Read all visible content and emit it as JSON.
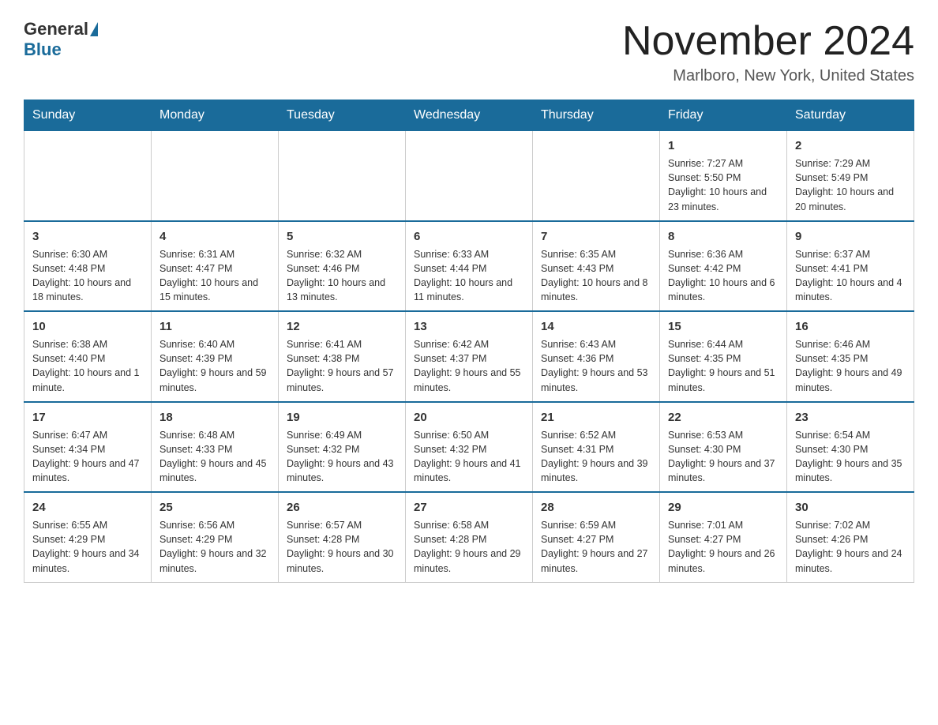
{
  "logo": {
    "general": "General",
    "blue": "Blue"
  },
  "header": {
    "title": "November 2024",
    "subtitle": "Marlboro, New York, United States"
  },
  "weekdays": [
    "Sunday",
    "Monday",
    "Tuesday",
    "Wednesday",
    "Thursday",
    "Friday",
    "Saturday"
  ],
  "weeks": [
    [
      {
        "day": "",
        "info": ""
      },
      {
        "day": "",
        "info": ""
      },
      {
        "day": "",
        "info": ""
      },
      {
        "day": "",
        "info": ""
      },
      {
        "day": "",
        "info": ""
      },
      {
        "day": "1",
        "info": "Sunrise: 7:27 AM\nSunset: 5:50 PM\nDaylight: 10 hours and 23 minutes."
      },
      {
        "day": "2",
        "info": "Sunrise: 7:29 AM\nSunset: 5:49 PM\nDaylight: 10 hours and 20 minutes."
      }
    ],
    [
      {
        "day": "3",
        "info": "Sunrise: 6:30 AM\nSunset: 4:48 PM\nDaylight: 10 hours and 18 minutes."
      },
      {
        "day": "4",
        "info": "Sunrise: 6:31 AM\nSunset: 4:47 PM\nDaylight: 10 hours and 15 minutes."
      },
      {
        "day": "5",
        "info": "Sunrise: 6:32 AM\nSunset: 4:46 PM\nDaylight: 10 hours and 13 minutes."
      },
      {
        "day": "6",
        "info": "Sunrise: 6:33 AM\nSunset: 4:44 PM\nDaylight: 10 hours and 11 minutes."
      },
      {
        "day": "7",
        "info": "Sunrise: 6:35 AM\nSunset: 4:43 PM\nDaylight: 10 hours and 8 minutes."
      },
      {
        "day": "8",
        "info": "Sunrise: 6:36 AM\nSunset: 4:42 PM\nDaylight: 10 hours and 6 minutes."
      },
      {
        "day": "9",
        "info": "Sunrise: 6:37 AM\nSunset: 4:41 PM\nDaylight: 10 hours and 4 minutes."
      }
    ],
    [
      {
        "day": "10",
        "info": "Sunrise: 6:38 AM\nSunset: 4:40 PM\nDaylight: 10 hours and 1 minute."
      },
      {
        "day": "11",
        "info": "Sunrise: 6:40 AM\nSunset: 4:39 PM\nDaylight: 9 hours and 59 minutes."
      },
      {
        "day": "12",
        "info": "Sunrise: 6:41 AM\nSunset: 4:38 PM\nDaylight: 9 hours and 57 minutes."
      },
      {
        "day": "13",
        "info": "Sunrise: 6:42 AM\nSunset: 4:37 PM\nDaylight: 9 hours and 55 minutes."
      },
      {
        "day": "14",
        "info": "Sunrise: 6:43 AM\nSunset: 4:36 PM\nDaylight: 9 hours and 53 minutes."
      },
      {
        "day": "15",
        "info": "Sunrise: 6:44 AM\nSunset: 4:35 PM\nDaylight: 9 hours and 51 minutes."
      },
      {
        "day": "16",
        "info": "Sunrise: 6:46 AM\nSunset: 4:35 PM\nDaylight: 9 hours and 49 minutes."
      }
    ],
    [
      {
        "day": "17",
        "info": "Sunrise: 6:47 AM\nSunset: 4:34 PM\nDaylight: 9 hours and 47 minutes."
      },
      {
        "day": "18",
        "info": "Sunrise: 6:48 AM\nSunset: 4:33 PM\nDaylight: 9 hours and 45 minutes."
      },
      {
        "day": "19",
        "info": "Sunrise: 6:49 AM\nSunset: 4:32 PM\nDaylight: 9 hours and 43 minutes."
      },
      {
        "day": "20",
        "info": "Sunrise: 6:50 AM\nSunset: 4:32 PM\nDaylight: 9 hours and 41 minutes."
      },
      {
        "day": "21",
        "info": "Sunrise: 6:52 AM\nSunset: 4:31 PM\nDaylight: 9 hours and 39 minutes."
      },
      {
        "day": "22",
        "info": "Sunrise: 6:53 AM\nSunset: 4:30 PM\nDaylight: 9 hours and 37 minutes."
      },
      {
        "day": "23",
        "info": "Sunrise: 6:54 AM\nSunset: 4:30 PM\nDaylight: 9 hours and 35 minutes."
      }
    ],
    [
      {
        "day": "24",
        "info": "Sunrise: 6:55 AM\nSunset: 4:29 PM\nDaylight: 9 hours and 34 minutes."
      },
      {
        "day": "25",
        "info": "Sunrise: 6:56 AM\nSunset: 4:29 PM\nDaylight: 9 hours and 32 minutes."
      },
      {
        "day": "26",
        "info": "Sunrise: 6:57 AM\nSunset: 4:28 PM\nDaylight: 9 hours and 30 minutes."
      },
      {
        "day": "27",
        "info": "Sunrise: 6:58 AM\nSunset: 4:28 PM\nDaylight: 9 hours and 29 minutes."
      },
      {
        "day": "28",
        "info": "Sunrise: 6:59 AM\nSunset: 4:27 PM\nDaylight: 9 hours and 27 minutes."
      },
      {
        "day": "29",
        "info": "Sunrise: 7:01 AM\nSunset: 4:27 PM\nDaylight: 9 hours and 26 minutes."
      },
      {
        "day": "30",
        "info": "Sunrise: 7:02 AM\nSunset: 4:26 PM\nDaylight: 9 hours and 24 minutes."
      }
    ]
  ]
}
